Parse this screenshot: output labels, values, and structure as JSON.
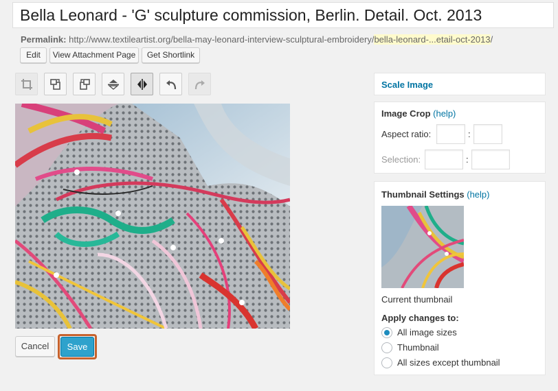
{
  "post_title": "Bella Leonard - 'G' sculpture commission, Berlin. Detail. Oct. 2013",
  "permalink": {
    "label": "Permalink:",
    "base_url": "http://www.textileartist.org/bella-may-leonard-interview-sculptural-embroidery/",
    "slug": "bella-leonard-...etail-oct-2013",
    "trailing": "/"
  },
  "actions": {
    "edit": "Edit",
    "view_attachment": "View Attachment Page",
    "get_shortlink": "Get Shortlink"
  },
  "toolbar": {
    "items": [
      "crop-icon",
      "rotate-left-icon",
      "rotate-right-icon",
      "flip-vertical-icon",
      "flip-horizontal-icon",
      "undo-icon",
      "redo-icon"
    ]
  },
  "editor": {
    "cancel": "Cancel",
    "save": "Save",
    "save_highlight_color": "#c6622d"
  },
  "scale_image": {
    "title": "Scale Image"
  },
  "image_crop": {
    "title": "Image Crop",
    "help": "(help)",
    "aspect_ratio_label": "Aspect ratio:",
    "selection_label": "Selection:",
    "separator": ":",
    "aspect_w": "",
    "aspect_h": "",
    "sel_w": "",
    "sel_h": ""
  },
  "thumbnail_settings": {
    "title": "Thumbnail Settings",
    "help": "(help)",
    "current_thumbnail": "Current thumbnail",
    "apply_label": "Apply changes to:",
    "options": [
      "All image sizes",
      "Thumbnail",
      "All sizes except thumbnail"
    ],
    "selected": "All image sizes"
  },
  "colors": {
    "link": "#0074a2",
    "primary_button": "#2ea2cc"
  }
}
